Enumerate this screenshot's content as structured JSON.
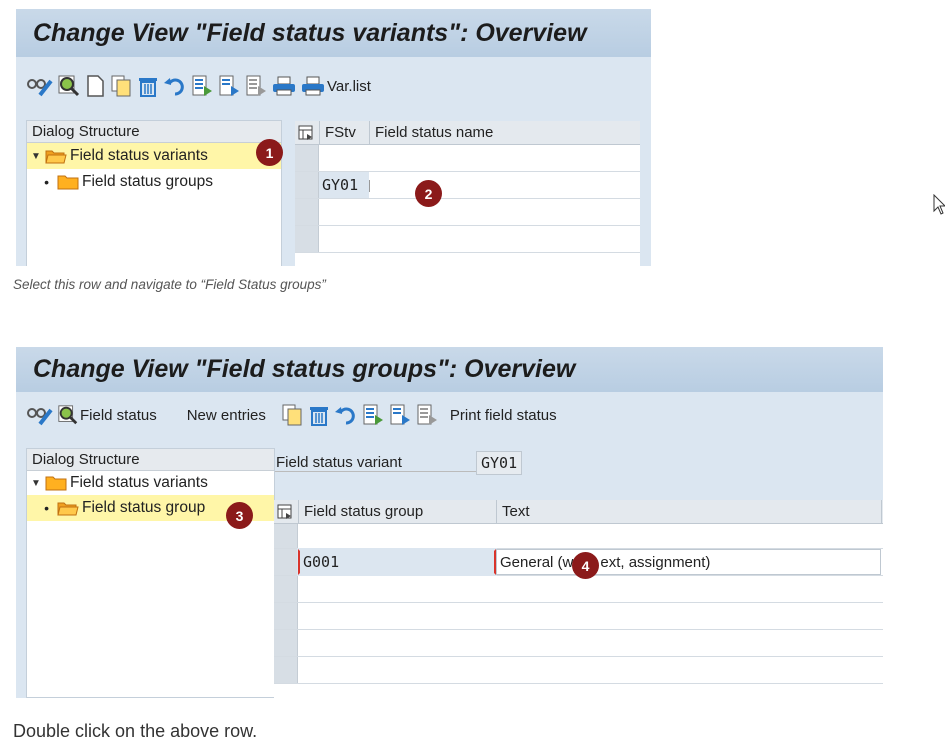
{
  "screen1": {
    "title": "Change View \"Field status variants\": Overview",
    "toolbar": {
      "icons": [
        "glasses-pencil-icon",
        "magnifier-icon",
        "new-document-icon",
        "copy-icon",
        "delete-icon",
        "undo-icon",
        "select-all-icon",
        "select-block-icon",
        "deselect-icon",
        "print-icon",
        "print-list-icon"
      ],
      "varlist_label": "Var.list"
    },
    "dialog": {
      "header": "Dialog Structure",
      "items": [
        {
          "label": "Field status variants",
          "expanded": true,
          "selected": true
        },
        {
          "label": "Field status groups",
          "expanded": false,
          "selected": false
        }
      ]
    },
    "table": {
      "col_key": "FStv",
      "col_name": "Field status name",
      "rows": [
        {
          "key": "GY01",
          "name": ""
        }
      ]
    },
    "badges": [
      "1",
      "2"
    ],
    "caption": "Select this row and navigate to “Field Status groups”"
  },
  "screen2": {
    "title": "Change View \"Field status groups\": Overview",
    "toolbar": {
      "field_status_label": "Field status",
      "new_entries_label": "New entries",
      "print_label": "Print field status"
    },
    "dialog": {
      "header": "Dialog Structure",
      "items": [
        {
          "label": "Field status variants",
          "expanded": true,
          "selected": false
        },
        {
          "label": "Field status group",
          "expanded": false,
          "selected": true
        }
      ]
    },
    "variant": {
      "label": "Field status variant",
      "value": "GY01"
    },
    "table": {
      "col_group": "Field status group",
      "col_text": "Text",
      "rows": [
        {
          "group": "G001",
          "text": "General (w",
          "text_tail": "ext, assignment)"
        }
      ]
    },
    "badges": [
      "3",
      "4"
    ],
    "caption": "Double click on the above row."
  },
  "colors": {
    "badge": "#8b1a1a",
    "selected": "#fff6a8",
    "toolbar": "#dbe6f1",
    "title": "#c0d3e6"
  }
}
